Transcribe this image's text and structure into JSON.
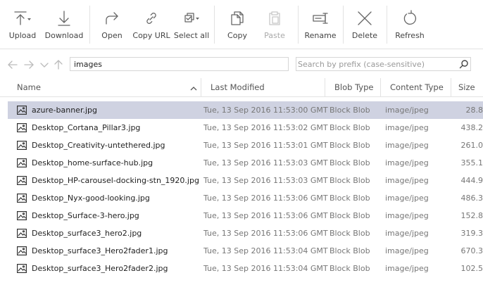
{
  "toolbar": {
    "upload": "Upload",
    "download": "Download",
    "open": "Open",
    "copy_url": "Copy URL",
    "select_all": "Select all",
    "copy": "Copy",
    "paste": "Paste",
    "rename": "Rename",
    "delete": "Delete",
    "refresh": "Refresh"
  },
  "address": {
    "path": "images",
    "search_placeholder": "Search by prefix (case-sensitive)"
  },
  "columns": {
    "name": "Name",
    "last_modified": "Last Modified",
    "blob_type": "Blob Type",
    "content_type": "Content Type",
    "size": "Size"
  },
  "rows": [
    {
      "name": "azure-banner.jpg",
      "modified": "Tue, 13 Sep 2016 11:53:00 GMT",
      "blob_type": "Block Blob",
      "content_type": "image/jpeg",
      "size": "28.8",
      "selected": true
    },
    {
      "name": "Desktop_Cortana_Pillar3.jpg",
      "modified": "Tue, 13 Sep 2016 11:53:02 GMT",
      "blob_type": "Block Blob",
      "content_type": "image/jpeg",
      "size": "438.2",
      "selected": false
    },
    {
      "name": "Desktop_Creativity-untethered.jpg",
      "modified": "Tue, 13 Sep 2016 11:53:01 GMT",
      "blob_type": "Block Blob",
      "content_type": "image/jpeg",
      "size": "261.0",
      "selected": false
    },
    {
      "name": "Desktop_home-surface-hub.jpg",
      "modified": "Tue, 13 Sep 2016 11:53:03 GMT",
      "blob_type": "Block Blob",
      "content_type": "image/jpeg",
      "size": "355.1",
      "selected": false
    },
    {
      "name": "Desktop_HP-carousel-docking-stn_1920.jpg",
      "modified": "Tue, 13 Sep 2016 11:53:03 GMT",
      "blob_type": "Block Blob",
      "content_type": "image/jpeg",
      "size": "444.9",
      "selected": false
    },
    {
      "name": "Desktop_Nyx-good-looking.jpg",
      "modified": "Tue, 13 Sep 2016 11:53:06 GMT",
      "blob_type": "Block Blob",
      "content_type": "image/jpeg",
      "size": "486.3",
      "selected": false
    },
    {
      "name": "Desktop_Surface-3-hero.jpg",
      "modified": "Tue, 13 Sep 2016 11:53:06 GMT",
      "blob_type": "Block Blob",
      "content_type": "image/jpeg",
      "size": "152.8",
      "selected": false
    },
    {
      "name": "Desktop_surface3_hero2.jpg",
      "modified": "Tue, 13 Sep 2016 11:53:06 GMT",
      "blob_type": "Block Blob",
      "content_type": "image/jpeg",
      "size": "319.3",
      "selected": false
    },
    {
      "name": "Desktop_surface3_Hero2fader1.jpg",
      "modified": "Tue, 13 Sep 2016 11:53:04 GMT",
      "blob_type": "Block Blob",
      "content_type": "image/jpeg",
      "size": "670.3",
      "selected": false
    },
    {
      "name": "Desktop_surface3_Hero2fader2.jpg",
      "modified": "Tue, 13 Sep 2016 11:53:04 GMT",
      "blob_type": "Block Blob",
      "content_type": "image/jpeg",
      "size": "102.5",
      "selected": false
    }
  ],
  "colors": {
    "selection": "#cfd2e1",
    "icon_stroke": "#666666",
    "disabled": "#c8c8c8"
  }
}
